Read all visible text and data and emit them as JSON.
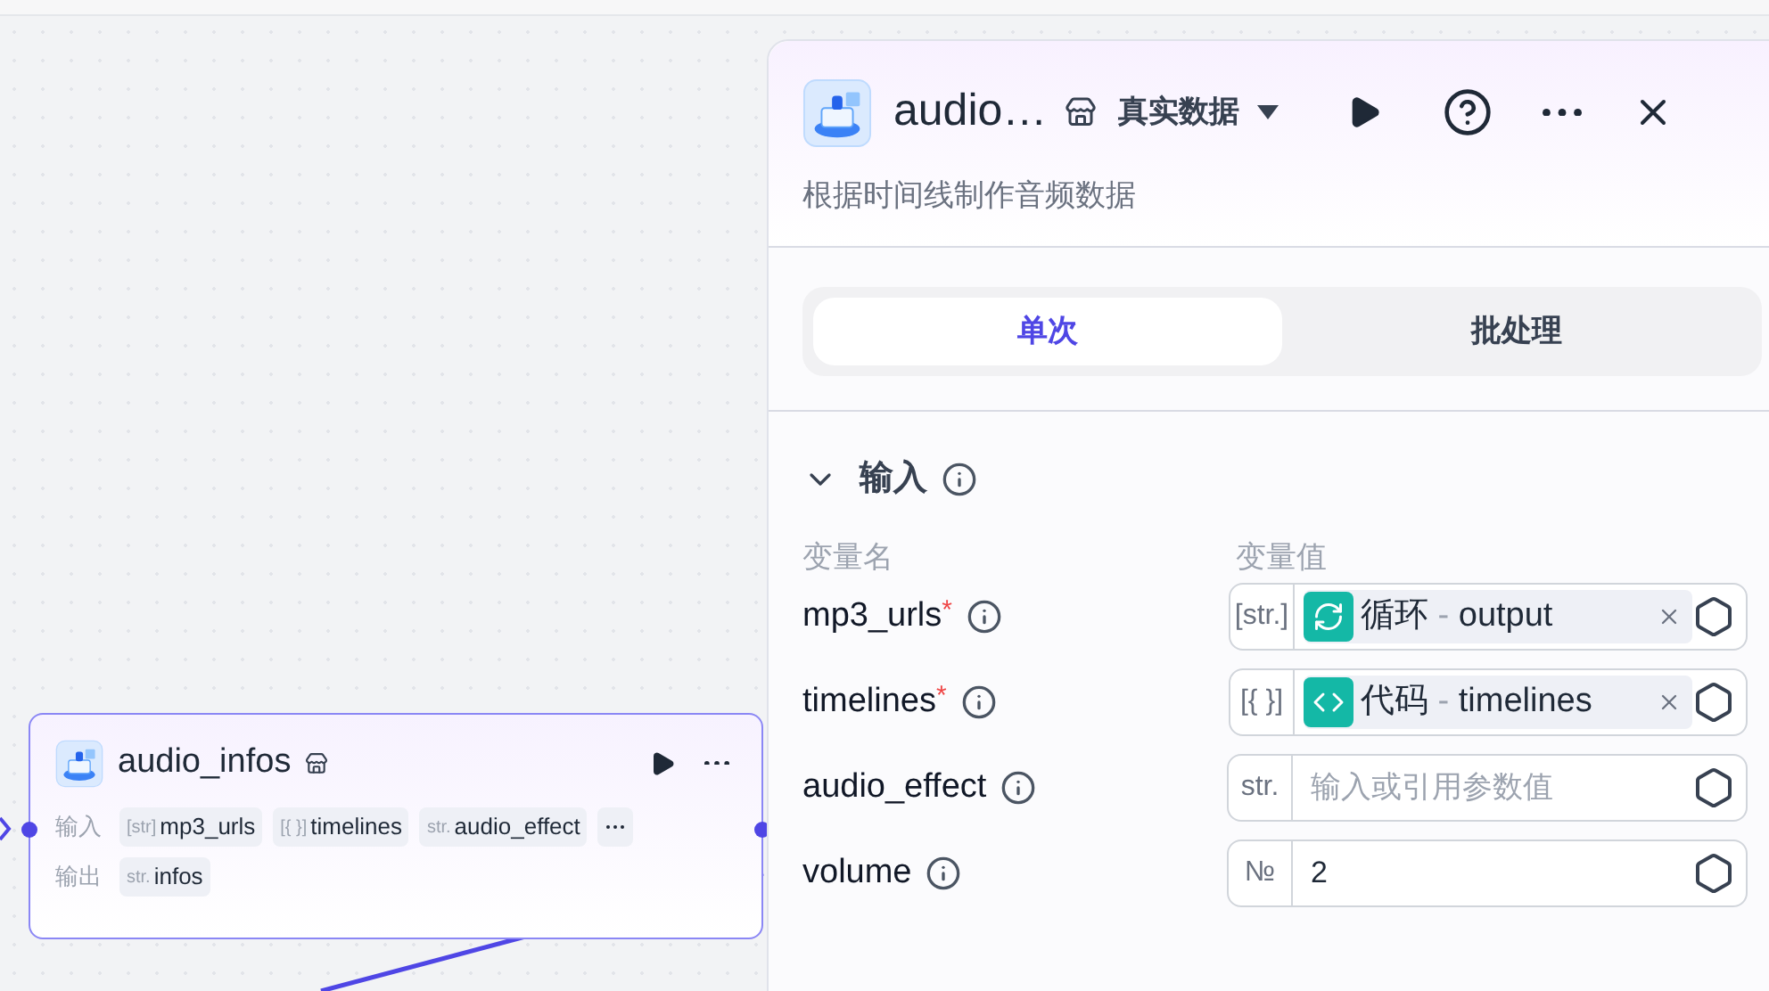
{
  "node": {
    "title": "audio_infos",
    "inputs_label": "输入",
    "inputs": [
      {
        "type": "[str]",
        "name": "mp3_urls"
      },
      {
        "type": "[{ }]",
        "name": "timelines"
      },
      {
        "type": "str.",
        "name": "audio_effect"
      }
    ],
    "outputs_label": "输出",
    "outputs": [
      {
        "type": "str.",
        "name": "infos"
      }
    ]
  },
  "panel": {
    "title": "audio…",
    "data_mode": "真实数据",
    "description": "根据时间线制作音频数据",
    "tabs": [
      {
        "label": "单次",
        "selected": true
      },
      {
        "label": "批处理",
        "selected": false
      }
    ],
    "section": {
      "title": "输入",
      "expanded": true,
      "name_header": "变量名",
      "value_header": "变量值",
      "params": [
        {
          "name": "mp3_urls",
          "required_mark": "*",
          "type": "[str.]",
          "kind": "reference",
          "source": {
            "kind": "loop",
            "label": "循环"
          },
          "separator": "-",
          "field": "output"
        },
        {
          "name": "timelines",
          "required_mark": "*",
          "type": "[{ }]",
          "kind": "reference",
          "source": {
            "kind": "code",
            "label": "代码"
          },
          "separator": "-",
          "field": "timelines"
        },
        {
          "name": "audio_effect",
          "type": "str.",
          "kind": "input",
          "placeholder": "输入或引用参数值"
        },
        {
          "name": "volume",
          "type": "№",
          "kind": "input",
          "value": "2"
        }
      ]
    }
  }
}
